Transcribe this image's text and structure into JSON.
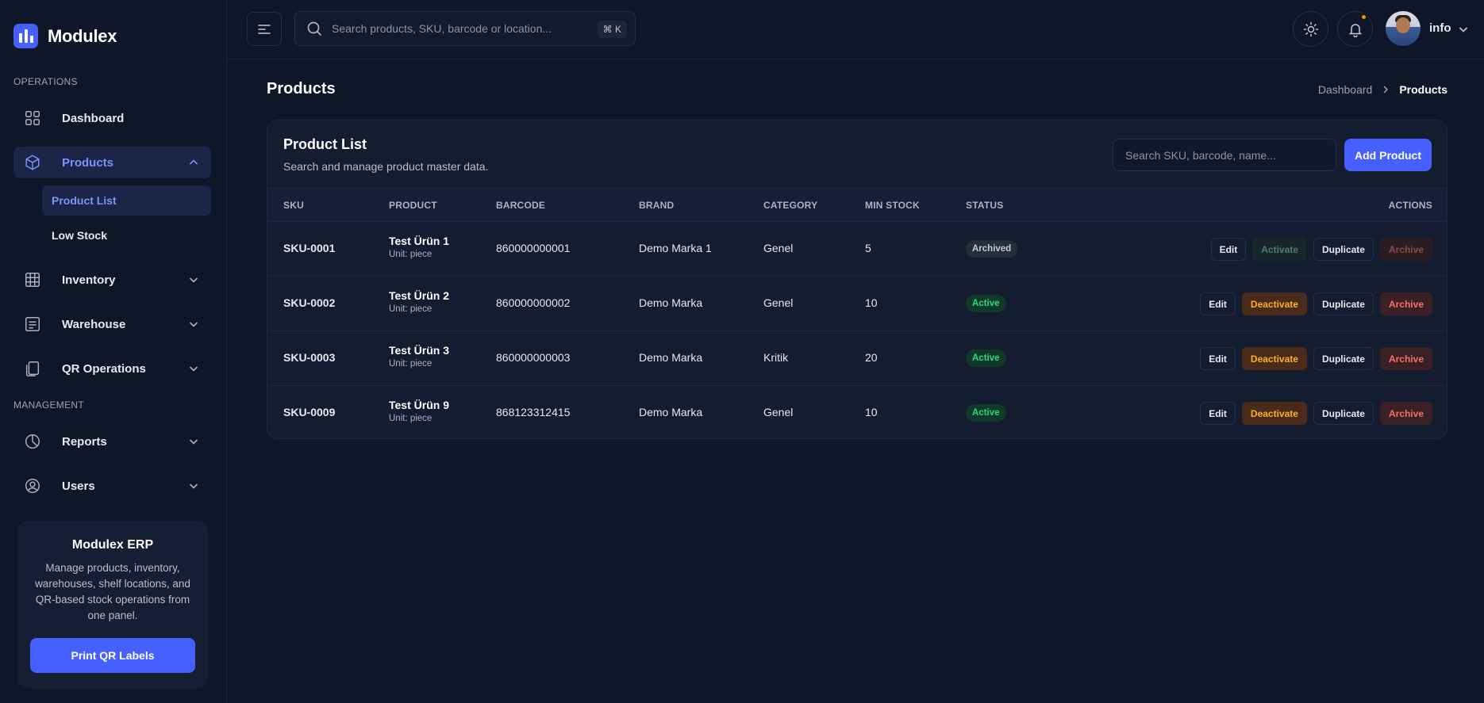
{
  "brand": {
    "name": "Modulex"
  },
  "sidebar": {
    "section_operations": "OPERATIONS",
    "section_management": "MANAGEMENT",
    "items": [
      {
        "label": "Dashboard",
        "icon": "grid-icon"
      },
      {
        "label": "Products",
        "icon": "box-icon",
        "active": true,
        "expanded": true
      },
      {
        "label": "Inventory",
        "icon": "table-icon"
      },
      {
        "label": "Warehouse",
        "icon": "list-icon"
      },
      {
        "label": "QR Operations",
        "icon": "copy-icon"
      },
      {
        "label": "Reports",
        "icon": "pie-chart-icon"
      },
      {
        "label": "Users",
        "icon": "user-circle-icon"
      }
    ],
    "sub_items": [
      {
        "label": "Product List",
        "active": true
      },
      {
        "label": "Low Stock"
      }
    ],
    "promo": {
      "title": "Modulex ERP",
      "text": "Manage products, inventory, warehouses, shelf locations, and QR-based stock operations from one panel.",
      "button": "Print QR Labels"
    }
  },
  "header": {
    "search_placeholder": "Search products, SKU, barcode or location...",
    "shortcut": "⌘ K",
    "user_name": "info"
  },
  "page": {
    "title": "Products",
    "breadcrumb": [
      "Dashboard",
      "Products"
    ]
  },
  "card": {
    "title": "Product List",
    "subtitle": "Search and manage product master data.",
    "search_placeholder": "Search SKU, barcode, name...",
    "add_button": "Add Product"
  },
  "table": {
    "columns": [
      "SKU",
      "PRODUCT",
      "BARCODE",
      "BRAND",
      "CATEGORY",
      "MIN STOCK",
      "STATUS",
      "ACTIONS"
    ],
    "rows": [
      {
        "sku": "SKU-0001",
        "product": "Test Ürün 1",
        "unit": "Unit: piece",
        "barcode": "860000000001",
        "brand": "Demo Marka 1",
        "category": "Genel",
        "min_stock": "5",
        "status": "Archived",
        "toggle": "Activate"
      },
      {
        "sku": "SKU-0002",
        "product": "Test Ürün 2",
        "unit": "Unit: piece",
        "barcode": "860000000002",
        "brand": "Demo Marka",
        "category": "Genel",
        "min_stock": "10",
        "status": "Active",
        "toggle": "Deactivate"
      },
      {
        "sku": "SKU-0003",
        "product": "Test Ürün 3",
        "unit": "Unit: piece",
        "barcode": "860000000003",
        "brand": "Demo Marka",
        "category": "Kritik",
        "min_stock": "20",
        "status": "Active",
        "toggle": "Deactivate"
      },
      {
        "sku": "SKU-0009",
        "product": "Test Ürün 9",
        "unit": "Unit: piece",
        "barcode": "868123312415",
        "brand": "Demo Marka",
        "category": "Genel",
        "min_stock": "10",
        "status": "Active",
        "toggle": "Deactivate"
      }
    ],
    "action_labels": {
      "edit": "Edit",
      "duplicate": "Duplicate",
      "archive": "Archive"
    }
  },
  "colors": {
    "accent": "#465fff",
    "background": "#0f1628",
    "active_green": "#32d583",
    "warning": "#fdb022",
    "danger": "#f97066"
  }
}
